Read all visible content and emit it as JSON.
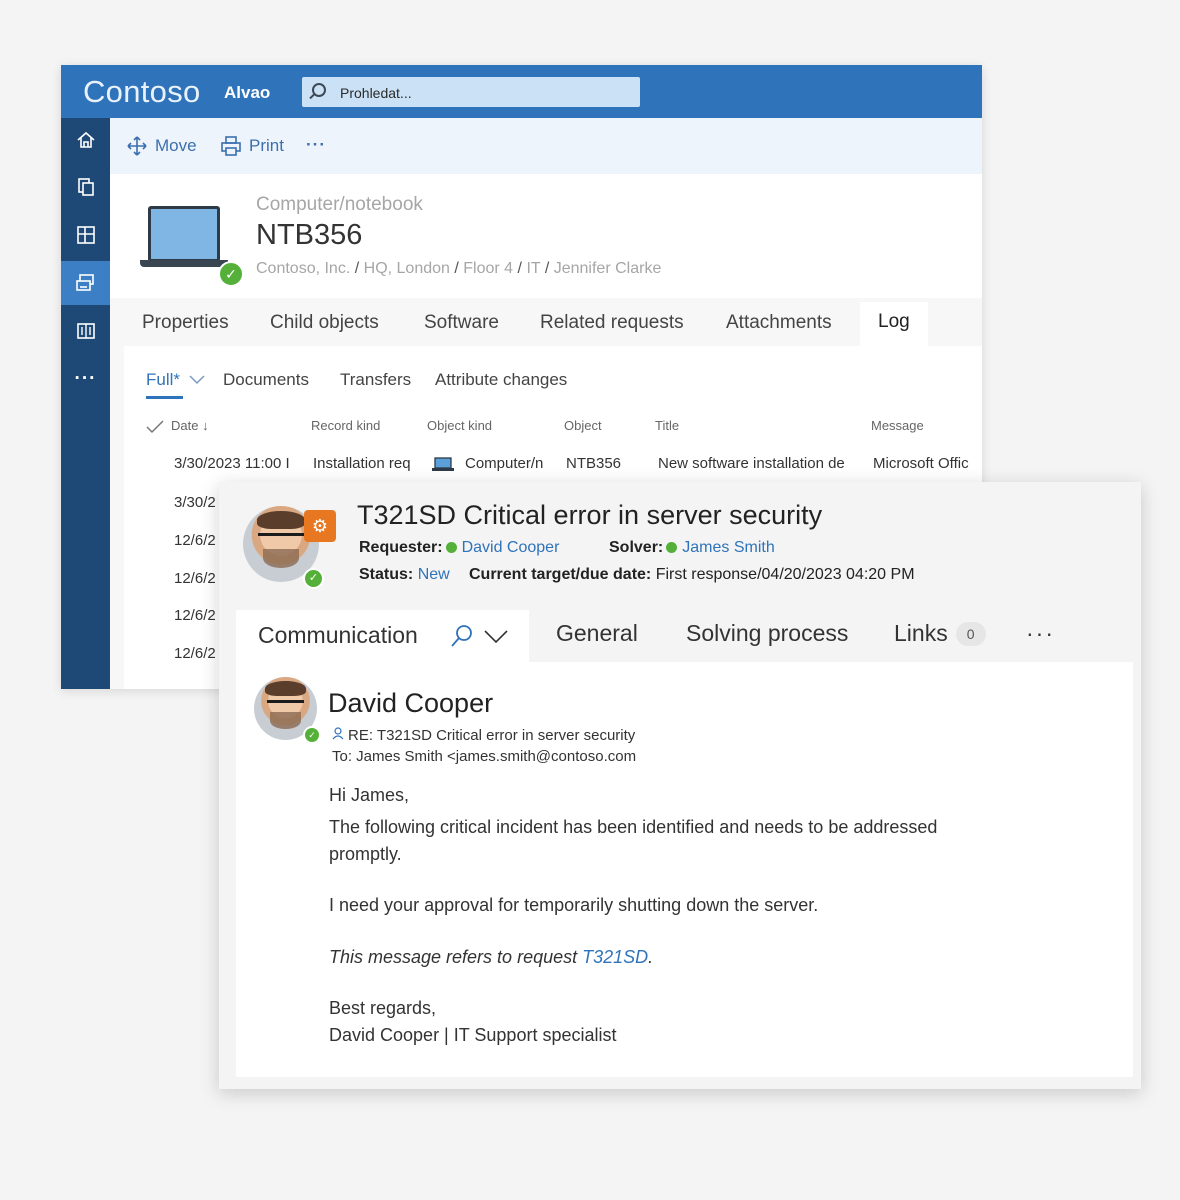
{
  "app": {
    "brand": "Contoso",
    "product": "Alvao",
    "search_placeholder": "Prohledat..."
  },
  "sidebar": {
    "items": [
      {
        "icon": "home-icon"
      },
      {
        "icon": "copy-icon"
      },
      {
        "icon": "dashboard-icon"
      },
      {
        "icon": "assets-icon"
      },
      {
        "icon": "book-icon"
      },
      {
        "icon": "more-icon"
      }
    ],
    "more_label": "···"
  },
  "toolbar": {
    "move_label": "Move",
    "print_label": "Print",
    "more_label": "···"
  },
  "object": {
    "type": "Computer/notebook",
    "name": "NTB356",
    "breadcrumb": [
      "Contoso, Inc.",
      "HQ, London",
      "Floor 4",
      "IT",
      "Jennifer Clarke"
    ],
    "breadcrumb_sep": "/"
  },
  "object_tabs": [
    "Properties",
    "Child objects",
    "Software",
    "Related requests",
    "Attachments",
    "Log"
  ],
  "log": {
    "subtabs": [
      "Full*",
      "Documents",
      "Transfers",
      "Attribute changes"
    ],
    "columns": [
      "Date",
      "Record kind",
      "Object kind",
      "Object",
      "Title",
      "Message"
    ],
    "rows": [
      {
        "date": "3/30/2023 11:00 I",
        "record_kind": "Installation req",
        "object_kind": "Computer/n",
        "object": "NTB356",
        "title": "New software installation de",
        "message": "Microsoft Offic"
      },
      {
        "date": "3/30/2"
      },
      {
        "date": "12/6/2"
      },
      {
        "date": "12/6/2"
      },
      {
        "date": "12/6/2"
      },
      {
        "date": "12/6/2"
      }
    ]
  },
  "request": {
    "icon_glyph": "⚙",
    "title": "T321SD Critical error in server security",
    "requester_label": "Requester:",
    "requester": "David Cooper",
    "solver_label": "Solver:",
    "solver": "James Smith",
    "status_label": "Status:",
    "status": "New",
    "due_label": "Current target/due date:",
    "due_value": "First response/04/20/2023 04:20 PM"
  },
  "request_tabs": {
    "communication": "Communication",
    "general": "General",
    "solving": "Solving process",
    "links": "Links",
    "links_count": "0",
    "more": "···"
  },
  "message": {
    "sender": "David Cooper",
    "subject": "RE: T321SD Critical error in server security",
    "to": "To: James Smith <james.smith@contoso.com",
    "greeting": "Hi James,",
    "para1": "The following critical incident has been identified and needs to be addressed promptly.",
    "para2": "I need your approval for temporarily shutting down the server.",
    "ref_text": "This message refers to request ",
    "ref_link": "T321SD",
    "ref_end": ".",
    "closing": "Best regards,",
    "signature": "David Cooper | IT Support specialist"
  },
  "colors": {
    "header_blue": "#2f73ba",
    "sidebar_navy": "#1e4976",
    "link_blue": "#2f73ba",
    "online_green": "#55b03a",
    "request_orange": "#e87722"
  }
}
